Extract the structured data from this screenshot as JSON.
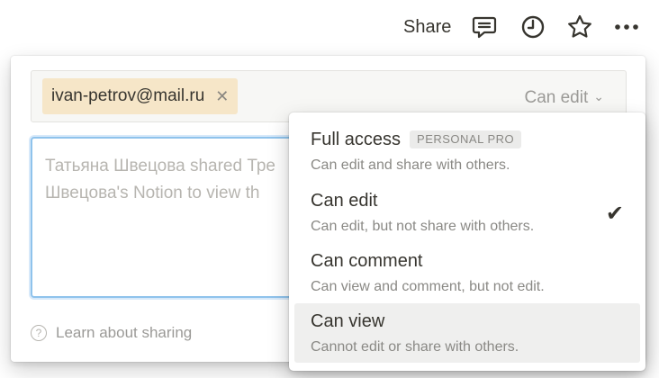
{
  "topbar": {
    "share_label": "Share",
    "icons": [
      "comment-icon",
      "clock-icon",
      "star-icon",
      "more-icon"
    ]
  },
  "invite": {
    "chip_email": "ivan-petrov@mail.ru",
    "chip_close": "✕",
    "permission_value": "Can edit",
    "chevron": "⌄"
  },
  "message": {
    "placeholder": "Татьяна Швецова shared Тре\nШвецова's Notion to view th"
  },
  "footer": {
    "learn_label": "Learn about sharing",
    "help_glyph": "?"
  },
  "menu": {
    "selected": "Can edit",
    "options": [
      {
        "title": "Full access",
        "badge": "PERSONAL PRO",
        "desc": "Can edit and share with others."
      },
      {
        "title": "Can edit",
        "desc": "Can edit, but not share with others.",
        "check": "✔"
      },
      {
        "title": "Can comment",
        "desc": "Can view and comment, but not edit."
      },
      {
        "title": "Can view",
        "desc": "Cannot edit or share with others."
      }
    ]
  },
  "colors": {
    "chip_bg": "#f6e6c8",
    "focus_border": "#8fc3ec",
    "hover_bg": "#efefee",
    "text": "#37352f",
    "muted": "#9b9a97"
  }
}
